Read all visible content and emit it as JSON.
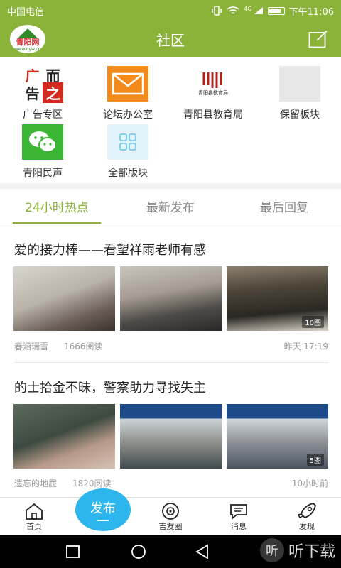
{
  "status_bar": {
    "carrier": "中国电信",
    "signal_text": "4G",
    "time": "下午11:06"
  },
  "header": {
    "title": "社区",
    "logo_text": "青阳网",
    "logo_sub": "www.qyw.cn"
  },
  "boards": [
    {
      "label": "广告专区",
      "icon": "ad-zone-icon",
      "glyphs": [
        "广",
        "而",
        "告",
        "之"
      ]
    },
    {
      "label": "论坛办公室",
      "icon": "mail-icon"
    },
    {
      "label": "青阳县教育局",
      "icon": "education-bureau-icon",
      "logo_caption": "青阳县教育局"
    },
    {
      "label": "保留板块",
      "icon": "placeholder-icon"
    },
    {
      "label": "青阳民声",
      "icon": "wechat-icon"
    },
    {
      "label": "全部版块",
      "icon": "grid-icon"
    }
  ],
  "tabs": [
    {
      "label": "24小时热点",
      "active": true
    },
    {
      "label": "最新发布",
      "active": false
    },
    {
      "label": "最后回复",
      "active": false
    }
  ],
  "posts": [
    {
      "title": "爱的接力棒——看望祥雨老师有感",
      "author": "春涵瑞雪",
      "reads": "1666阅读",
      "time": "昨天 17:19",
      "image_count": "10图"
    },
    {
      "title": "的士拾金不昧，警察助力寻找失主",
      "author": "遗忘的地屁",
      "reads": "1820阅读",
      "time": "10小时前",
      "image_count": "5图"
    }
  ],
  "bottom_nav": {
    "home": "首页",
    "publish": "发布",
    "friends": "吉友圈",
    "messages": "消息",
    "discover": "发现"
  },
  "watermark": {
    "text": "听下载",
    "glyph": "听"
  },
  "colors": {
    "accent": "#8bb33a",
    "publish": "#2db6ee"
  }
}
